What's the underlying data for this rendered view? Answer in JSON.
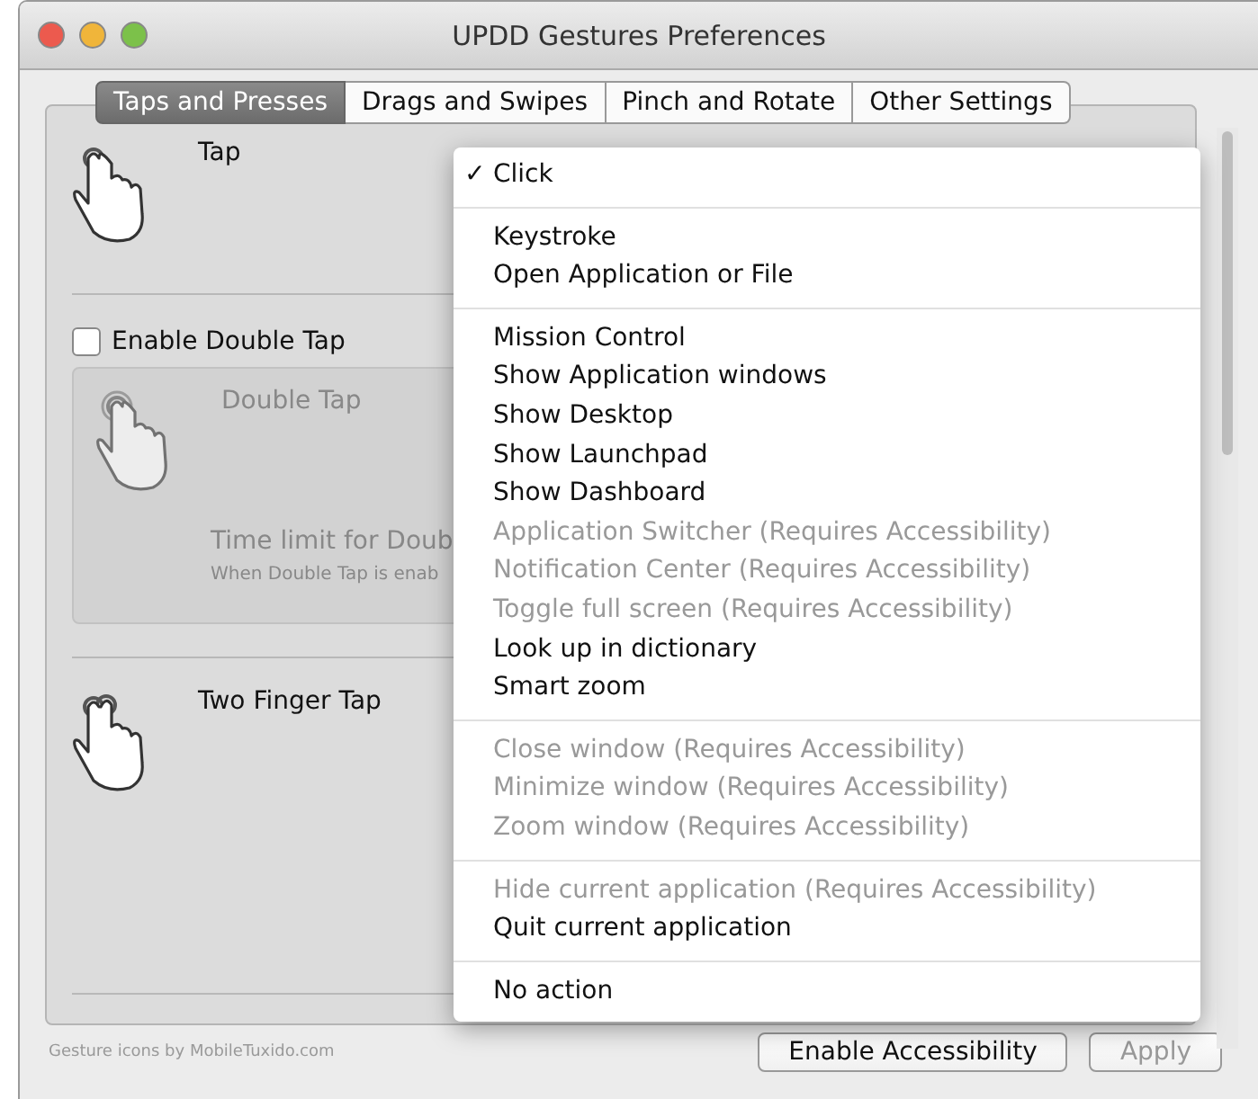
{
  "window": {
    "title": "UPDD Gestures Preferences"
  },
  "tabs": [
    {
      "label": "Taps and Presses",
      "selected": true
    },
    {
      "label": "Drags and Swipes",
      "selected": false
    },
    {
      "label": "Pinch and Rotate",
      "selected": false
    },
    {
      "label": "Other Settings",
      "selected": false
    }
  ],
  "gestures": [
    {
      "kind": "tap",
      "title": "Tap",
      "disabled": false
    },
    {
      "kind": "double",
      "checkbox": {
        "label": "Enable Double Tap",
        "checked": false
      },
      "title": "Double Tap",
      "disabled": true,
      "time_limit_label": "Time limit for Doub",
      "note": "When Double Tap is enab"
    },
    {
      "kind": "two",
      "title": "Two Finger Tap",
      "disabled": false
    }
  ],
  "menu": [
    [
      {
        "label": "Click",
        "checked": true,
        "disabled": false
      }
    ],
    [
      {
        "label": "Keystroke",
        "checked": false,
        "disabled": false
      },
      {
        "label": "Open Application or File",
        "checked": false,
        "disabled": false
      }
    ],
    [
      {
        "label": "Mission Control",
        "checked": false,
        "disabled": false
      },
      {
        "label": "Show Application windows",
        "checked": false,
        "disabled": false
      },
      {
        "label": "Show Desktop",
        "checked": false,
        "disabled": false
      },
      {
        "label": "Show Launchpad",
        "checked": false,
        "disabled": false
      },
      {
        "label": "Show Dashboard",
        "checked": false,
        "disabled": false
      },
      {
        "label": "Application Switcher (Requires Accessibility)",
        "checked": false,
        "disabled": true
      },
      {
        "label": "Notification Center (Requires Accessibility)",
        "checked": false,
        "disabled": true
      },
      {
        "label": "Toggle full screen (Requires Accessibility)",
        "checked": false,
        "disabled": true
      },
      {
        "label": "Look up in dictionary",
        "checked": false,
        "disabled": false
      },
      {
        "label": "Smart zoom",
        "checked": false,
        "disabled": false
      }
    ],
    [
      {
        "label": "Close window (Requires Accessibility)",
        "checked": false,
        "disabled": true
      },
      {
        "label": "Minimize window (Requires Accessibility)",
        "checked": false,
        "disabled": true
      },
      {
        "label": "Zoom window (Requires Accessibility)",
        "checked": false,
        "disabled": true
      }
    ],
    [
      {
        "label": "Hide current application (Requires Accessibility)",
        "checked": false,
        "disabled": true
      },
      {
        "label": "Quit current application",
        "checked": false,
        "disabled": false
      }
    ],
    [
      {
        "label": "No action",
        "checked": false,
        "disabled": false
      }
    ]
  ],
  "check_mark": "✓",
  "footer": {
    "credit": "Gesture icons by MobileTuxido.com",
    "buttons": [
      {
        "label": "Enable Accessibility",
        "disabled": false
      },
      {
        "label": "Apply",
        "disabled": true
      }
    ]
  }
}
